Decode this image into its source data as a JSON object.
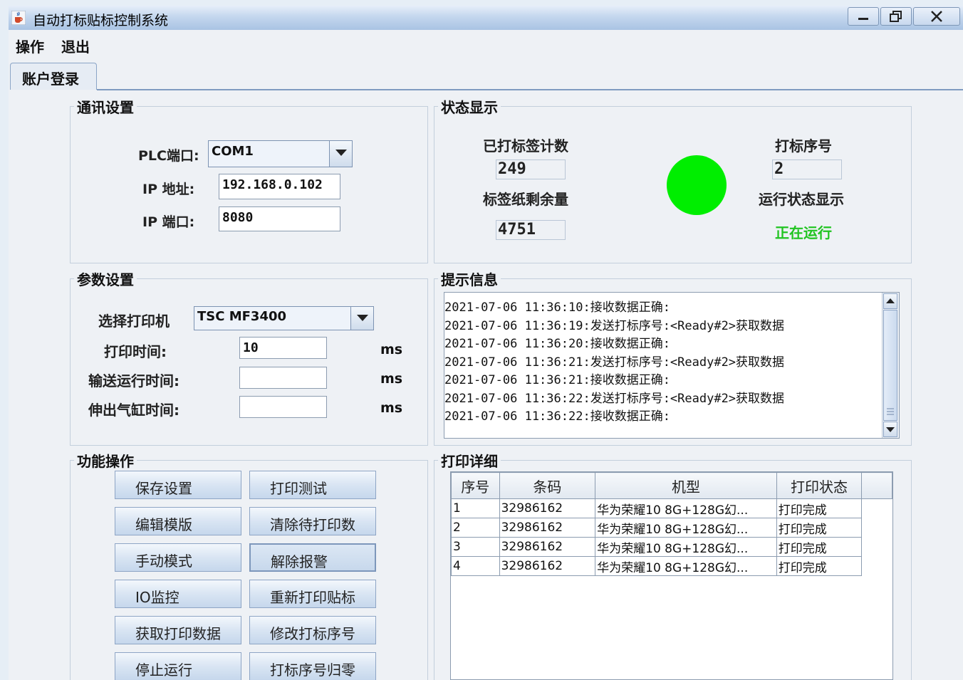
{
  "window": {
    "title": "自动打标贴标控制系统"
  },
  "menu": {
    "items": [
      "操作",
      "退出"
    ]
  },
  "tab": {
    "label": "账户登录"
  },
  "comm": {
    "title": "通讯设置",
    "plc_port_label": "PLC端口:",
    "plc_port_value": "COM1",
    "ip_label": "IP 地址:",
    "ip_value": "192.168.0.102",
    "port_label": "IP 端口:",
    "port_value": "8080"
  },
  "status": {
    "title": "状态显示",
    "printed_count_label": "已打标签计数",
    "printed_count_value": "249",
    "remaining_label": "标签纸剩余量",
    "remaining_value": "4751",
    "serial_label": "打标序号",
    "serial_value": "2",
    "run_status_label": "运行状态显示",
    "run_status_value": "正在运行",
    "indicator_color": "#00ee00",
    "run_status_color": "#22c422"
  },
  "params": {
    "title": "参数设置",
    "printer_label": "选择打印机",
    "printer_value": "TSC MF3400",
    "print_time_label": "打印时间:",
    "print_time_value": "10",
    "convey_time_label": "输送运行时间:",
    "convey_time_value": "",
    "cylinder_time_label": "伸出气缸时间:",
    "cylinder_time_value": "",
    "unit": "ms"
  },
  "functions": {
    "title": "功能操作",
    "buttons": [
      "保存设置",
      "打印测试",
      "编辑模版",
      "清除待打印数",
      "手动模式",
      "解除报警",
      "IO监控",
      "重新打印贴标",
      "获取打印数据",
      "修改打标序号",
      "停止运行",
      "打标序号归零"
    ]
  },
  "messages": {
    "title": "提示信息",
    "lines": [
      "2021-07-06 11:36:10:接收数据正确:",
      "2021-07-06 11:36:19:发送打标序号:<Ready#2>获取数据",
      "2021-07-06 11:36:20:接收数据正确:",
      "2021-07-06 11:36:21:发送打标序号:<Ready#2>获取数据",
      "2021-07-06 11:36:21:接收数据正确:",
      "2021-07-06 11:36:22:发送打标序号:<Ready#2>获取数据",
      "2021-07-06 11:36:22:接收数据正确:"
    ]
  },
  "print_details": {
    "title": "打印详细",
    "columns": [
      "序号",
      "条码",
      "机型",
      "打印状态"
    ],
    "rows": [
      [
        "1",
        "32986162",
        "华为荣耀10 8G+128G幻...",
        "打印完成"
      ],
      [
        "2",
        "32986162",
        "华为荣耀10 8G+128G幻...",
        "打印完成"
      ],
      [
        "3",
        "32986162",
        "华为荣耀10 8G+128G幻...",
        "打印完成"
      ],
      [
        "4",
        "32986162",
        "华为荣耀10 8G+128G幻...",
        "打印完成"
      ]
    ]
  }
}
